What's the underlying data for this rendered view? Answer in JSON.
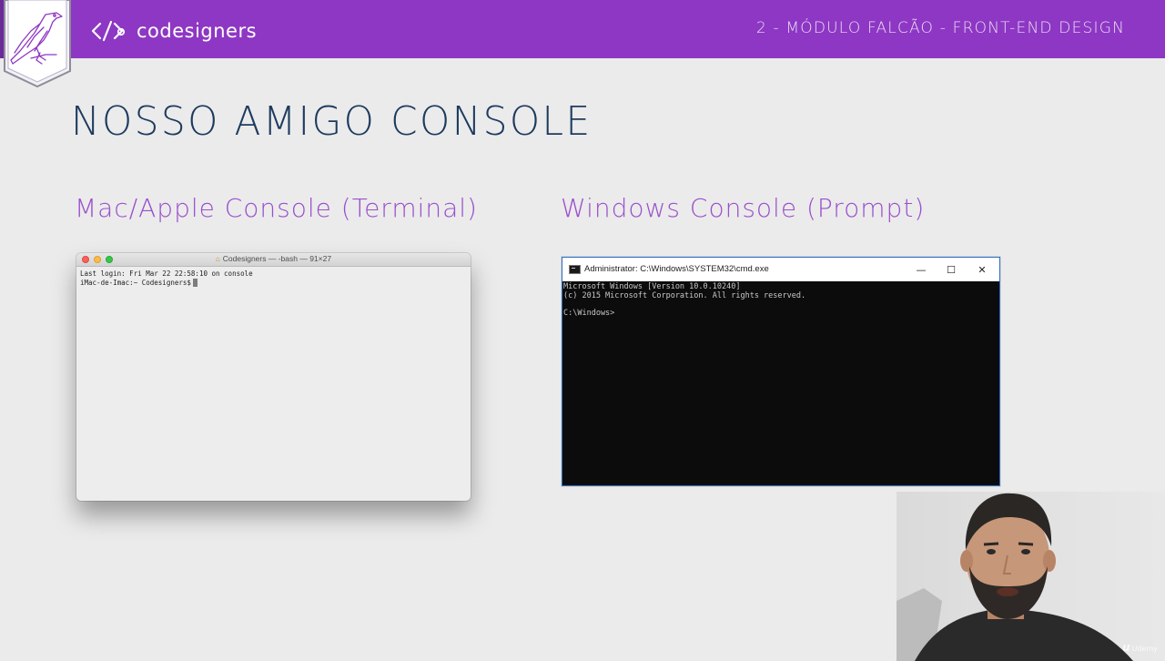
{
  "header": {
    "brand_name": "codesigners",
    "module_label": "2 - MÓDULO FALCÃO - FRONT-END DESIGN",
    "color": "#8e37c4"
  },
  "slide": {
    "title": "NOSSO AMIGO CONSOLE",
    "mac_section_title": "Mac/Apple Console (Terminal)",
    "windows_section_title": "Windows Console (Prompt)"
  },
  "mac_terminal": {
    "title": "Codesigners — -bash — 91×27",
    "icon": "home-folder-icon",
    "lines": [
      "Last login: Fri Mar 22 22:58:10 on console",
      "iMac-de-Imac:~ Codesigners$"
    ]
  },
  "windows_cmd": {
    "title": "Administrator: C:\\Windows\\SYSTEM32\\cmd.exe",
    "controls": {
      "minimize": "—",
      "maximize": "☐",
      "close": "✕"
    },
    "lines": [
      "Microsoft Windows [Version 10.0.10240]",
      "(c) 2015 Microsoft Corporation. All rights reserved.",
      "",
      "C:\\Windows>"
    ]
  },
  "watermark": {
    "logo": "u",
    "text": "Udemy"
  }
}
